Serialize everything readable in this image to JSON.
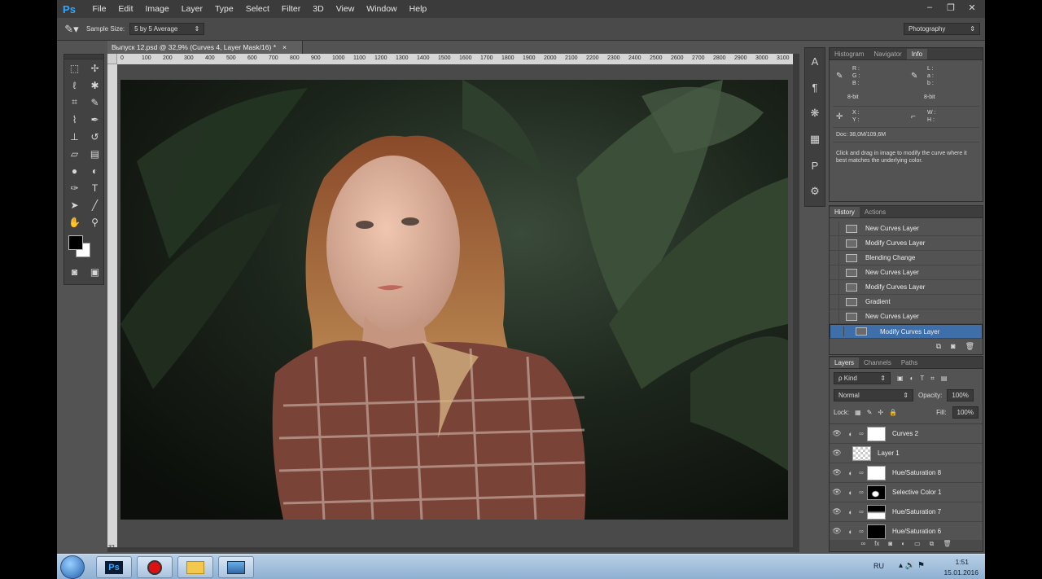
{
  "app": {
    "logo": "Ps"
  },
  "menu": [
    "File",
    "Edit",
    "Image",
    "Layer",
    "Type",
    "Select",
    "Filter",
    "3D",
    "View",
    "Window",
    "Help"
  ],
  "window_controls": [
    "‒",
    "❐",
    "✕"
  ],
  "options": {
    "sample_size_label": "Sample Size:",
    "sample_size_value": "5 by 5 Average",
    "workspace": "Photography"
  },
  "document": {
    "tab_title": "Выпуск 12.psd @ 32,9% (Curves 4, Layer Mask/16) *",
    "zoom": "32",
    "ruler_labels": [
      "0",
      "100",
      "200",
      "300",
      "400",
      "500",
      "600",
      "700",
      "800",
      "900",
      "1000",
      "1100",
      "1200",
      "1300",
      "1400",
      "1500",
      "1600",
      "1700",
      "1800",
      "1900",
      "2000",
      "2100",
      "2200",
      "2300",
      "2400",
      "2500",
      "2600",
      "2700",
      "2800",
      "2900",
      "3000",
      "3100"
    ]
  },
  "info_panel": {
    "tabs": [
      "Histogram",
      "Navigator",
      "Info"
    ],
    "rgb": "R :\nG :\nB :",
    "lab": "L :\na :\nb :",
    "bit1": "8-bit",
    "bit2": "8-bit",
    "xy": "X :\nY :",
    "wh": "W :\nH :",
    "doc": "Doc: 38,0M/109,6M",
    "hint": "Click and drag in image to modify the curve where it best matches the underlying color."
  },
  "history_panel": {
    "tabs": [
      "History",
      "Actions"
    ],
    "items": [
      "New Curves Layer",
      "Modify Curves Layer",
      "Blending Change",
      "New Curves Layer",
      "Modify Curves Layer",
      "Gradient",
      "New Curves Layer",
      "Modify Curves Layer"
    ]
  },
  "layers_panel": {
    "tabs": [
      "Layers",
      "Channels",
      "Paths"
    ],
    "kind": "ρ Kind",
    "blend": "Normal",
    "opacity_label": "Opacity:",
    "opacity": "100%",
    "lock_label": "Lock:",
    "fill_label": "Fill:",
    "fill": "100%",
    "layers": [
      "Curves 2",
      "Layer 1",
      "Hue/Saturation 8",
      "Selective Color 1",
      "Hue/Saturation 7",
      "Hue/Saturation 6"
    ]
  },
  "taskbar": {
    "lang": "RU",
    "time": "1:51",
    "date": "15.01.2016"
  }
}
